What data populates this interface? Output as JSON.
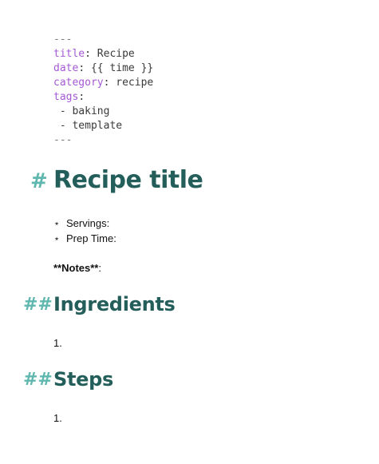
{
  "frontmatter": {
    "delimiter": "---",
    "fields": [
      {
        "key": "title",
        "sep": ": ",
        "value": "Recipe"
      },
      {
        "key": "date",
        "sep": ": ",
        "value": "{{ time }}"
      },
      {
        "key": "category",
        "sep": ": ",
        "value": "recipe"
      },
      {
        "key": "tags",
        "sep": ":",
        "value": ""
      }
    ],
    "tags_items": [
      " - baking",
      " - template"
    ]
  },
  "h1": {
    "marker": "#",
    "text": "Recipe title"
  },
  "meta_list": {
    "bullet": "⋆",
    "items": [
      "Servings:",
      "Prep Time:"
    ]
  },
  "notes": {
    "label": "**Notes**",
    "suffix": ":"
  },
  "ingredients": {
    "marker": "##",
    "heading": "Ingredients",
    "first_item": "1."
  },
  "steps": {
    "marker": "##",
    "heading": "Steps",
    "first_item": "1."
  },
  "colors": {
    "heading": "#235e5a",
    "hash_marker": "#5fb7ae",
    "frontmatter_key": "#a45ad6"
  }
}
